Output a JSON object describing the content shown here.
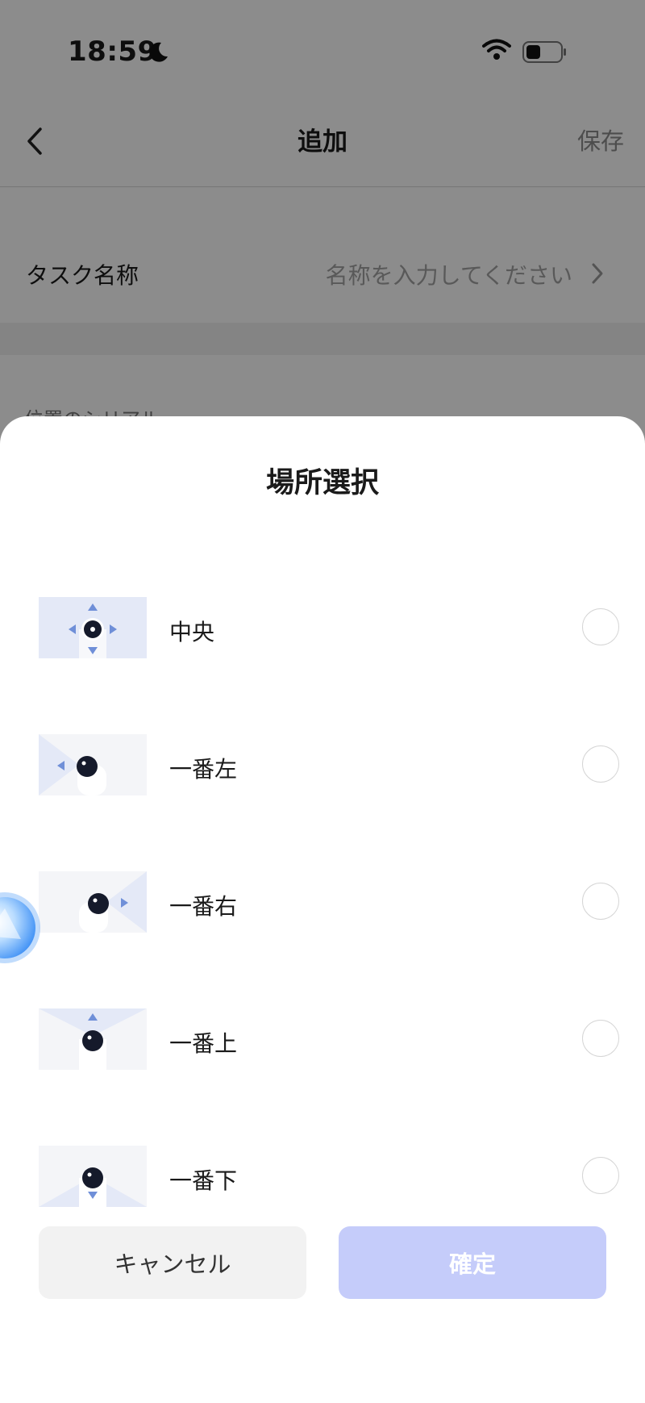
{
  "status": {
    "time": "18:59"
  },
  "nav": {
    "title": "追加",
    "save_label": "保存"
  },
  "form": {
    "task_label": "タスク名称",
    "task_placeholder": "名称を入力してください",
    "serial_label": "位置のシリアル"
  },
  "sheet": {
    "title": "場所選択",
    "options": [
      {
        "label": "中央",
        "icon": "center-position-icon"
      },
      {
        "label": "一番左",
        "icon": "left-position-icon"
      },
      {
        "label": "一番右",
        "icon": "right-position-icon"
      },
      {
        "label": "一番上",
        "icon": "top-position-icon"
      },
      {
        "label": "一番下",
        "icon": "bottom-position-icon"
      }
    ],
    "cancel_label": "キャンセル",
    "confirm_label": "確定"
  },
  "colors": {
    "accent_arrow": "#6f8fd8",
    "thumb_highlight": "#e4e9f7",
    "confirm_disabled": "#c5ccfa",
    "overlay": "rgba(0,0,0,0.45)"
  }
}
